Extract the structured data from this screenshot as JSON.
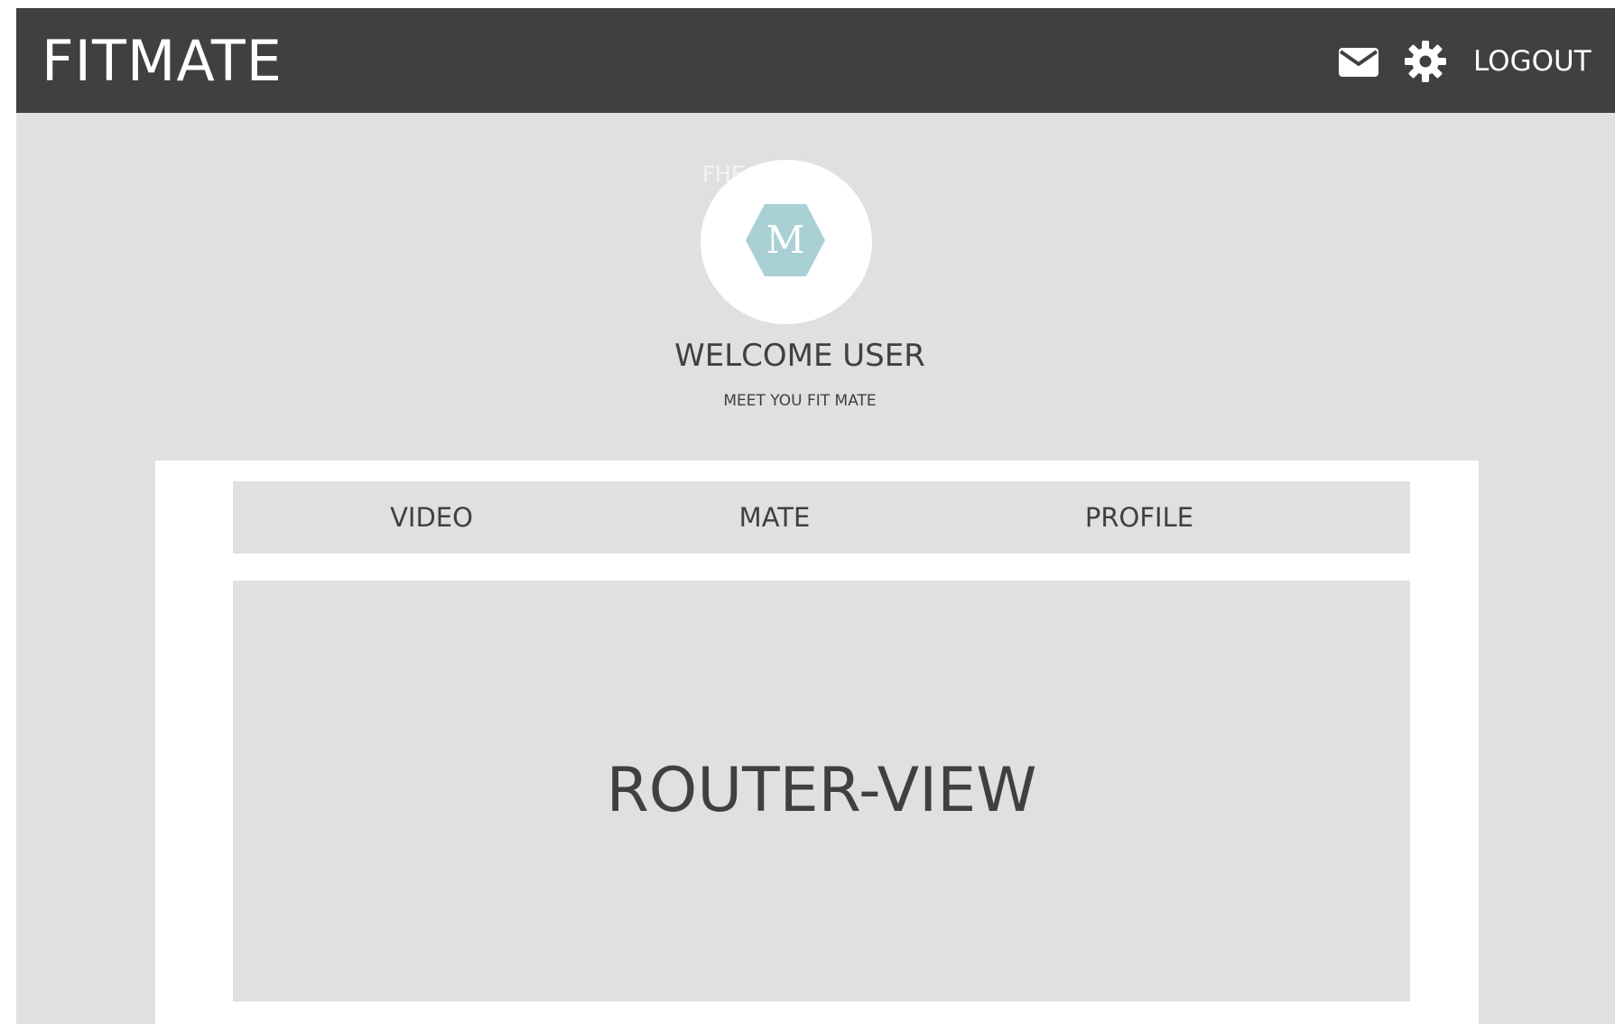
{
  "header": {
    "brand": "FITMATE",
    "mail_icon": "mail-icon",
    "settings_icon": "gear-icon",
    "logout_label": "LOGOUT"
  },
  "profile": {
    "faint_label": "FHE",
    "avatar_icon": "hexagon-m-logo",
    "avatar_letter": "M",
    "avatar_color": "#a8d0d5",
    "welcome": "WELCOME USER",
    "tagline": "MEET YOU FIT MATE"
  },
  "tabs": [
    {
      "label": "VIDEO"
    },
    {
      "label": "MATE"
    },
    {
      "label": "PROFILE"
    }
  ],
  "content": {
    "placeholder": "ROUTER-VIEW"
  },
  "colors": {
    "header_bg": "#404040",
    "page_bg": "#e0e0e0",
    "panel_bg": "#ffffff",
    "text": "#404040"
  }
}
